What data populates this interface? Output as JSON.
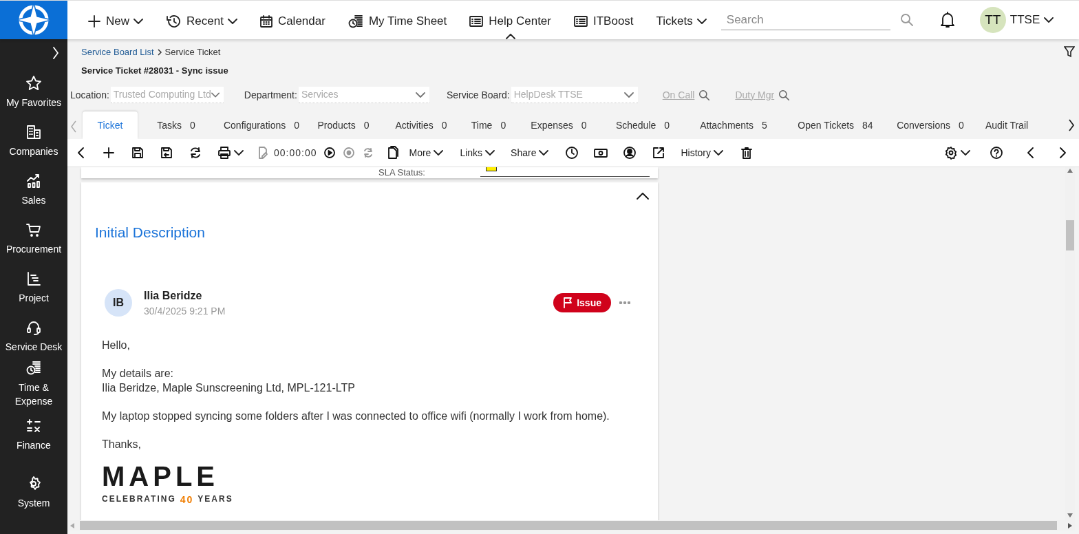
{
  "top_nav": {
    "items": [
      {
        "label": "New",
        "dropdown": true,
        "selected": false
      },
      {
        "label": "Recent",
        "dropdown": true,
        "selected": false
      },
      {
        "label": "Calendar",
        "dropdown": false,
        "selected": false
      },
      {
        "label": "My Time Sheet",
        "dropdown": false,
        "selected": false
      },
      {
        "label": "Help Center",
        "dropdown": false,
        "selected": true
      },
      {
        "label": "ITBoost",
        "dropdown": false,
        "selected": false
      },
      {
        "label": "Tickets",
        "dropdown": true,
        "selected": false
      }
    ],
    "search": {
      "placeholder": "Search"
    },
    "user": {
      "initials": "TT",
      "name": "TTSE"
    }
  },
  "sidebar": {
    "items": [
      {
        "label": "My Favorites"
      },
      {
        "label": "Companies"
      },
      {
        "label": "Sales"
      },
      {
        "label": "Procurement"
      },
      {
        "label": "Project"
      },
      {
        "label": "Service Desk"
      },
      {
        "label": "Time & Expense"
      },
      {
        "label": "Finance"
      },
      {
        "label": "System"
      }
    ]
  },
  "breadcrumb": {
    "link": "Service Board List",
    "current": "Service Ticket"
  },
  "page_title": "Service Ticket #28031 - Sync issue",
  "filters": [
    {
      "label": "Location:",
      "value": "Trusted Computing Ltd"
    },
    {
      "label": "Department:",
      "value": "Services"
    },
    {
      "label": "Service Board:",
      "value": "HelpDesk TTSE"
    }
  ],
  "lookup_links": [
    "On Call",
    "Duty Mgr"
  ],
  "tabs": [
    {
      "label": "Ticket",
      "selected": true
    },
    {
      "label": "Tasks",
      "count": "0",
      "selected": false
    },
    {
      "label": "Configurations",
      "count": "0",
      "selected": false
    },
    {
      "label": "Products",
      "count": "0",
      "selected": false
    },
    {
      "label": "Activities",
      "count": "0",
      "selected": false
    },
    {
      "label": "Time",
      "count": "0",
      "selected": false
    },
    {
      "label": "Expenses",
      "count": "0",
      "selected": false
    },
    {
      "label": "Schedule",
      "count": "0",
      "selected": false
    },
    {
      "label": "Attachments",
      "count": "5",
      "selected": false
    },
    {
      "label": "Open Tickets",
      "count": "84",
      "selected": false
    },
    {
      "label": "Conversions",
      "count": "0",
      "selected": false
    },
    {
      "label": "Audit Trail",
      "selected": false
    }
  ],
  "toolbar": {
    "timer": "00:00:00",
    "menus": [
      "More",
      "Links",
      "Share",
      "History"
    ]
  },
  "sla": {
    "label": "SLA Status:"
  },
  "description": {
    "title": "Initial Description",
    "author": {
      "initials": "IB",
      "name": "Ilia Beridze",
      "date": "30/4/2025 9:21 PM"
    },
    "tag": "Issue",
    "paragraphs": [
      "Hello,",
      "My details are:\nIlia Beridze, Maple Sunscreening Ltd, MPL-121-LTP",
      "My laptop stopped syncing some folders after I was connected to office wifi (normally I work from home).",
      "Thanks,"
    ],
    "signature": {
      "logo": "MAPLE",
      "tagline_start": "CELEBRATING",
      "tagline_number": "40",
      "tagline_end": "YEARS"
    }
  }
}
